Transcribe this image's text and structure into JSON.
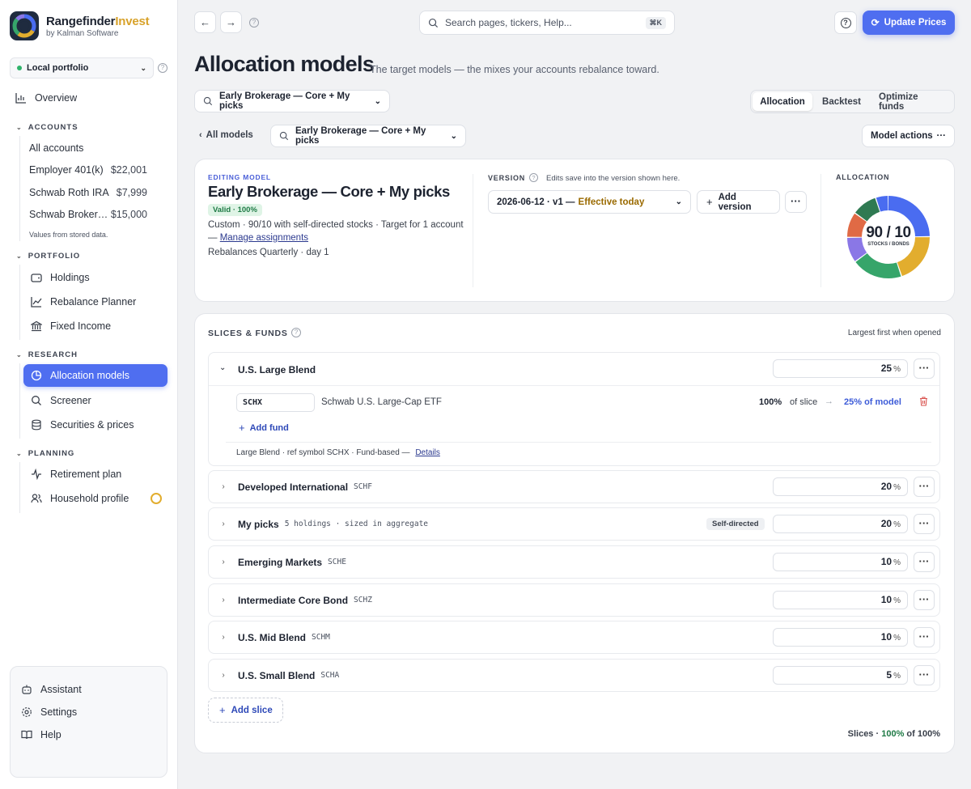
{
  "app": {
    "name_main": "Rangefinder",
    "name_accent": "Invest",
    "subtitle": "by Kalman Software"
  },
  "portfolio_selector": {
    "label": "Local portfolio"
  },
  "sidebar": {
    "overview": "Overview",
    "accounts_header": "ACCOUNTS",
    "accounts": [
      {
        "name": "All accounts",
        "amount": ""
      },
      {
        "name": "Employer 401(k)",
        "amount": "$22,001"
      },
      {
        "name": "Schwab Roth IRA",
        "amount": "$7,999"
      },
      {
        "name": "Schwab Broker…",
        "amount": "$15,000"
      }
    ],
    "accounts_note": "Values from stored data.",
    "portfolio_header": "PORTFOLIO",
    "portfolio_items": [
      "Holdings",
      "Rebalance Planner",
      "Fixed Income"
    ],
    "research_header": "RESEARCH",
    "research_items": [
      "Allocation models",
      "Screener",
      "Securities & prices"
    ],
    "planning_header": "PLANNING",
    "planning_items": [
      "Retirement plan",
      "Household profile"
    ],
    "bottom_items": [
      "Assistant",
      "Settings",
      "Help"
    ]
  },
  "topbar": {
    "search_placeholder": "Search pages, tickers, Help...",
    "search_shortcut": "⌘K",
    "update_button": "Update Prices"
  },
  "page": {
    "title": "Allocation models",
    "subtitle": "The target models — the mixes your accounts rebalance toward."
  },
  "model_picker": {
    "label": "Early Brokerage — Core + My picks"
  },
  "tabs": [
    {
      "label": "Allocation",
      "active": true
    },
    {
      "label": "Backtest",
      "active": false
    },
    {
      "label": "Optimize funds",
      "active": false
    }
  ],
  "breadcrumb": {
    "back": "All models",
    "model": "Early Brokerage — Core + My picks"
  },
  "model_actions": "Model actions",
  "editing": {
    "label": "EDITING MODEL",
    "name": "Early Brokerage — Core + My picks",
    "valid": "Valid · 100%",
    "desc": "Custom · 90/10 with self-directed stocks · Target for 1 account —",
    "manage_link": "Manage assignments",
    "rebalance": "Rebalances Quarterly · day 1"
  },
  "version": {
    "label": "VERSION",
    "hint": "Edits save into the version shown here.",
    "value": "2026-06-12 · v1 —",
    "effective": "Effective today",
    "add": "Add version"
  },
  "allocation": {
    "label": "ALLOCATION",
    "big": "90 / 10",
    "small": "STOCKS / BONDS"
  },
  "donut_colors": [
    "#4a6cf0",
    "#e2ad2e",
    "#36a56a",
    "#8a77e6",
    "#e06a45",
    "#2f7a52"
  ],
  "donut_values": [
    25,
    20,
    20,
    10,
    10,
    10,
    5
  ],
  "slices_section": {
    "title": "SLICES & FUNDS",
    "hint": "Largest first when opened"
  },
  "expanded_slice": {
    "name": "U.S. Large Blend",
    "percent": "25",
    "fund_ticker": "SCHX",
    "fund_name": "Schwab U.S. Large-Cap ETF",
    "fund_share": "100%",
    "of_slice": "of slice",
    "of_model": "25% of model",
    "add_fund": "Add fund",
    "meta": "Large Blend · ref symbol SCHX · Fund-based —",
    "details": "Details"
  },
  "slices": [
    {
      "name": "Developed International",
      "ticker": "SCHF",
      "percent": "20",
      "badge": ""
    },
    {
      "name": "My picks",
      "ticker": "5 holdings · sized in aggregate",
      "percent": "20",
      "badge": "Self-directed"
    },
    {
      "name": "Emerging Markets",
      "ticker": "SCHE",
      "percent": "10",
      "badge": ""
    },
    {
      "name": "Intermediate Core Bond",
      "ticker": "SCHZ",
      "percent": "10",
      "badge": ""
    },
    {
      "name": "U.S. Mid Blend",
      "ticker": "SCHM",
      "percent": "10",
      "badge": ""
    },
    {
      "name": "U.S. Small Blend",
      "ticker": "SCHA",
      "percent": "5",
      "badge": ""
    }
  ],
  "add_slice": "Add slice",
  "footer": {
    "prefix": "Slices ·",
    "value": "100%",
    "suffix": "of 100%"
  },
  "percent_unit": "%"
}
